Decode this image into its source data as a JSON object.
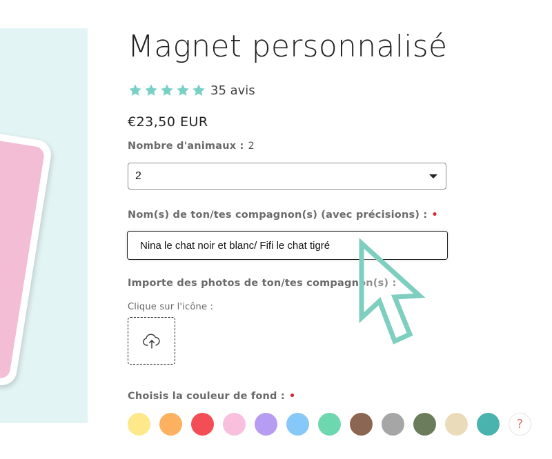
{
  "product": {
    "title": "Magnet personnalisé",
    "rating_stars": 5,
    "review_count": "35 avis",
    "price": "€23,50 EUR"
  },
  "animals_field": {
    "label": "Nombre d'animaux :",
    "current_value": "2",
    "select_value": "2"
  },
  "names_field": {
    "label": "Nom(s) de ton/tes compagnon(s) (avec précisions) :",
    "required_mark": "•",
    "value": "Nina le chat noir et blanc/ Fifi le chat tigré"
  },
  "photos_field": {
    "label": "Importe des photos de ton/tes compagnon(s) :",
    "required_mark": "•",
    "hint": "Clique sur l'icône :",
    "upload_icon": "cloud-upload-icon"
  },
  "background_color_field": {
    "label": "Choisis la couleur de fond :",
    "required_mark": "•",
    "swatches": [
      {
        "name": "yellow",
        "color": "#fde98a"
      },
      {
        "name": "orange",
        "color": "#fbb15f"
      },
      {
        "name": "red",
        "color": "#f34e55"
      },
      {
        "name": "pink",
        "color": "#f8c0dc"
      },
      {
        "name": "lavender",
        "color": "#b69cf2"
      },
      {
        "name": "light-blue",
        "color": "#86c8f7"
      },
      {
        "name": "mint",
        "color": "#6dd8b0"
      },
      {
        "name": "brown",
        "color": "#8b6650"
      },
      {
        "name": "gray",
        "color": "#a6a6a6"
      },
      {
        "name": "dark-green",
        "color": "#6a7c5c"
      },
      {
        "name": "beige",
        "color": "#eadbb9"
      },
      {
        "name": "teal",
        "color": "#4ab3ad"
      }
    ],
    "help_label": "?"
  },
  "colors": {
    "star": "#79d1c6",
    "required": "#d0292f",
    "cursor": "#7ecfc0",
    "image_bg": "#e3f4f4"
  }
}
